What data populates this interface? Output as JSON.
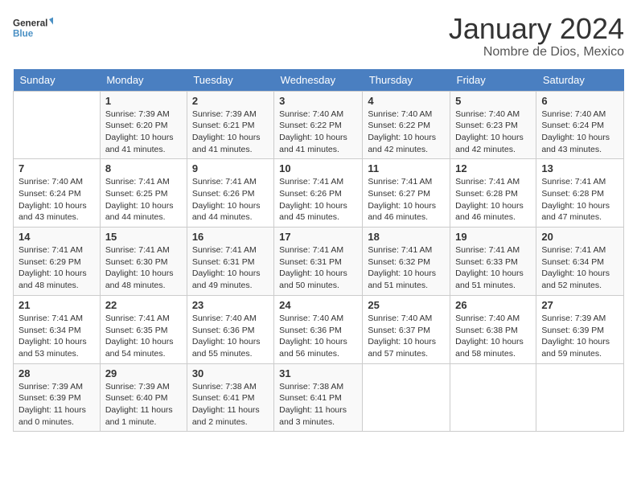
{
  "header": {
    "logo_line1": "General",
    "logo_line2": "Blue",
    "month": "January 2024",
    "location": "Nombre de Dios, Mexico"
  },
  "weekdays": [
    "Sunday",
    "Monday",
    "Tuesday",
    "Wednesday",
    "Thursday",
    "Friday",
    "Saturday"
  ],
  "weeks": [
    [
      {
        "day": "",
        "info": ""
      },
      {
        "day": "1",
        "info": "Sunrise: 7:39 AM\nSunset: 6:20 PM\nDaylight: 10 hours and 41 minutes."
      },
      {
        "day": "2",
        "info": "Sunrise: 7:39 AM\nSunset: 6:21 PM\nDaylight: 10 hours and 41 minutes."
      },
      {
        "day": "3",
        "info": "Sunrise: 7:40 AM\nSunset: 6:22 PM\nDaylight: 10 hours and 41 minutes."
      },
      {
        "day": "4",
        "info": "Sunrise: 7:40 AM\nSunset: 6:22 PM\nDaylight: 10 hours and 42 minutes."
      },
      {
        "day": "5",
        "info": "Sunrise: 7:40 AM\nSunset: 6:23 PM\nDaylight: 10 hours and 42 minutes."
      },
      {
        "day": "6",
        "info": "Sunrise: 7:40 AM\nSunset: 6:24 PM\nDaylight: 10 hours and 43 minutes."
      }
    ],
    [
      {
        "day": "7",
        "info": "Sunrise: 7:40 AM\nSunset: 6:24 PM\nDaylight: 10 hours and 43 minutes."
      },
      {
        "day": "8",
        "info": "Sunrise: 7:41 AM\nSunset: 6:25 PM\nDaylight: 10 hours and 44 minutes."
      },
      {
        "day": "9",
        "info": "Sunrise: 7:41 AM\nSunset: 6:26 PM\nDaylight: 10 hours and 44 minutes."
      },
      {
        "day": "10",
        "info": "Sunrise: 7:41 AM\nSunset: 6:26 PM\nDaylight: 10 hours and 45 minutes."
      },
      {
        "day": "11",
        "info": "Sunrise: 7:41 AM\nSunset: 6:27 PM\nDaylight: 10 hours and 46 minutes."
      },
      {
        "day": "12",
        "info": "Sunrise: 7:41 AM\nSunset: 6:28 PM\nDaylight: 10 hours and 46 minutes."
      },
      {
        "day": "13",
        "info": "Sunrise: 7:41 AM\nSunset: 6:28 PM\nDaylight: 10 hours and 47 minutes."
      }
    ],
    [
      {
        "day": "14",
        "info": "Sunrise: 7:41 AM\nSunset: 6:29 PM\nDaylight: 10 hours and 48 minutes."
      },
      {
        "day": "15",
        "info": "Sunrise: 7:41 AM\nSunset: 6:30 PM\nDaylight: 10 hours and 48 minutes."
      },
      {
        "day": "16",
        "info": "Sunrise: 7:41 AM\nSunset: 6:31 PM\nDaylight: 10 hours and 49 minutes."
      },
      {
        "day": "17",
        "info": "Sunrise: 7:41 AM\nSunset: 6:31 PM\nDaylight: 10 hours and 50 minutes."
      },
      {
        "day": "18",
        "info": "Sunrise: 7:41 AM\nSunset: 6:32 PM\nDaylight: 10 hours and 51 minutes."
      },
      {
        "day": "19",
        "info": "Sunrise: 7:41 AM\nSunset: 6:33 PM\nDaylight: 10 hours and 51 minutes."
      },
      {
        "day": "20",
        "info": "Sunrise: 7:41 AM\nSunset: 6:34 PM\nDaylight: 10 hours and 52 minutes."
      }
    ],
    [
      {
        "day": "21",
        "info": "Sunrise: 7:41 AM\nSunset: 6:34 PM\nDaylight: 10 hours and 53 minutes."
      },
      {
        "day": "22",
        "info": "Sunrise: 7:41 AM\nSunset: 6:35 PM\nDaylight: 10 hours and 54 minutes."
      },
      {
        "day": "23",
        "info": "Sunrise: 7:40 AM\nSunset: 6:36 PM\nDaylight: 10 hours and 55 minutes."
      },
      {
        "day": "24",
        "info": "Sunrise: 7:40 AM\nSunset: 6:36 PM\nDaylight: 10 hours and 56 minutes."
      },
      {
        "day": "25",
        "info": "Sunrise: 7:40 AM\nSunset: 6:37 PM\nDaylight: 10 hours and 57 minutes."
      },
      {
        "day": "26",
        "info": "Sunrise: 7:40 AM\nSunset: 6:38 PM\nDaylight: 10 hours and 58 minutes."
      },
      {
        "day": "27",
        "info": "Sunrise: 7:39 AM\nSunset: 6:39 PM\nDaylight: 10 hours and 59 minutes."
      }
    ],
    [
      {
        "day": "28",
        "info": "Sunrise: 7:39 AM\nSunset: 6:39 PM\nDaylight: 11 hours and 0 minutes."
      },
      {
        "day": "29",
        "info": "Sunrise: 7:39 AM\nSunset: 6:40 PM\nDaylight: 11 hours and 1 minute."
      },
      {
        "day": "30",
        "info": "Sunrise: 7:38 AM\nSunset: 6:41 PM\nDaylight: 11 hours and 2 minutes."
      },
      {
        "day": "31",
        "info": "Sunrise: 7:38 AM\nSunset: 6:41 PM\nDaylight: 11 hours and 3 minutes."
      },
      {
        "day": "",
        "info": ""
      },
      {
        "day": "",
        "info": ""
      },
      {
        "day": "",
        "info": ""
      }
    ]
  ]
}
